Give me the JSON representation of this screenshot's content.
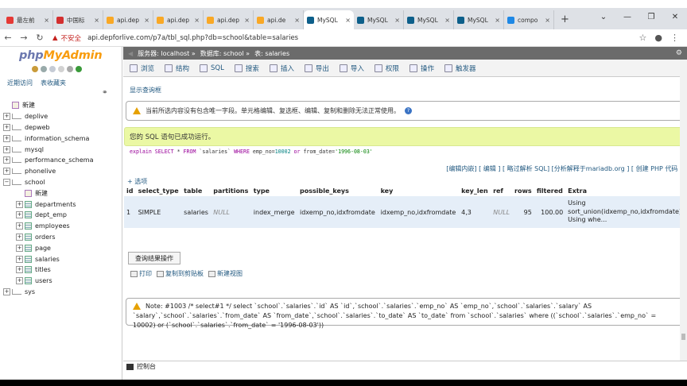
{
  "browser": {
    "tabs": [
      {
        "title": "最左前",
        "color": "#e53935",
        "active": false
      },
      {
        "title": "中国标",
        "color": "#d32f2f",
        "active": false
      },
      {
        "title": "api.dep",
        "color": "#f9a825",
        "active": false
      },
      {
        "title": "api.dep",
        "color": "#f9a825",
        "active": false
      },
      {
        "title": "api.dep",
        "color": "#f9a825",
        "active": false
      },
      {
        "title": "api.de",
        "color": "#f9a825",
        "active": false
      },
      {
        "title": "MySQL",
        "color": "#0d5f8a",
        "active": true
      },
      {
        "title": "MySQL",
        "color": "#0d5f8a",
        "active": false
      },
      {
        "title": "MySQL",
        "color": "#0d5f8a",
        "active": false
      },
      {
        "title": "MySQL",
        "color": "#0d5f8a",
        "active": false
      },
      {
        "title": "compo",
        "color": "#1e88e5",
        "active": false
      }
    ],
    "new_tab": "+",
    "insecure_label": "不安全",
    "url": "api.depforlive.com/p7a/tbl_sql.php?db=school&table=salaries"
  },
  "sidebar": {
    "logo_php": "php",
    "logo_myadmin": "MyAdmin",
    "recent": "近期访问",
    "favorites": "表收藏夹",
    "tree": [
      {
        "label": "新建",
        "level": 0,
        "type": "new",
        "exp": ""
      },
      {
        "label": "deplive",
        "level": 0,
        "type": "db",
        "exp": "+"
      },
      {
        "label": "depweb",
        "level": 0,
        "type": "db",
        "exp": "+"
      },
      {
        "label": "information_schema",
        "level": 0,
        "type": "db",
        "exp": "+"
      },
      {
        "label": "mysql",
        "level": 0,
        "type": "db",
        "exp": "+"
      },
      {
        "label": "performance_schema",
        "level": 0,
        "type": "db",
        "exp": "+"
      },
      {
        "label": "phonelive",
        "level": 0,
        "type": "db",
        "exp": "+"
      },
      {
        "label": "school",
        "level": 0,
        "type": "db",
        "exp": "−"
      },
      {
        "label": "新建",
        "level": 1,
        "type": "new",
        "exp": ""
      },
      {
        "label": "departments",
        "level": 1,
        "type": "table",
        "exp": "+"
      },
      {
        "label": "dept_emp",
        "level": 1,
        "type": "table",
        "exp": "+"
      },
      {
        "label": "employees",
        "level": 1,
        "type": "table",
        "exp": "+"
      },
      {
        "label": "orders",
        "level": 1,
        "type": "table",
        "exp": "+"
      },
      {
        "label": "page",
        "level": 1,
        "type": "table",
        "exp": "+"
      },
      {
        "label": "salaries",
        "level": 1,
        "type": "table",
        "exp": "+"
      },
      {
        "label": "titles",
        "level": 1,
        "type": "table",
        "exp": "+"
      },
      {
        "label": "users",
        "level": 1,
        "type": "table",
        "exp": "+"
      },
      {
        "label": "sys",
        "level": 0,
        "type": "db",
        "exp": "+"
      }
    ]
  },
  "breadcrumb": {
    "server": "服务器: localhost »",
    "db": "数据库: school »",
    "table": "表: salaries"
  },
  "menu": [
    "浏览",
    "结构",
    "SQL",
    "搜索",
    "插入",
    "导出",
    "导入",
    "权限",
    "操作",
    "触发器"
  ],
  "show_query": "显示查询框",
  "notice": "当前所选内容没有包含唯一字段。单元格编辑、复选框、编辑、复制和删除无法正常使用。",
  "success": "您的 SQL 语句已成功运行。",
  "sql": {
    "explain": "explain",
    "select": "SELECT",
    "star": " * ",
    "from": "FROM",
    "table": " `salaries` ",
    "where": "WHERE",
    "cond1": " emp_no=",
    "val1": "10002",
    "or": " or ",
    "cond2": "from_date=",
    "val2": "'1996-08-03'"
  },
  "sql_links": "[编辑内嵌] [ 编辑 ] [ 略过解析 SQL] [分析解释于mariadb.org ] [ 创建 PHP 代码 ]",
  "options": "+ 选项",
  "result": {
    "columns": [
      "id",
      "select_type",
      "table",
      "partitions",
      "type",
      "possible_keys",
      "key",
      "key_len",
      "ref",
      "rows",
      "filtered",
      "Extra"
    ],
    "rows": [
      {
        "id": "1",
        "select_type": "SIMPLE",
        "table": "salaries",
        "partitions": "NULL",
        "type": "index_merge",
        "possible_keys": "idxemp_no,idxfromdate",
        "key": "idxemp_no,idxfromdate",
        "key_len": "4,3",
        "ref": "NULL",
        "rows": "95",
        "filtered": "100.00",
        "extra_1": "Using",
        "extra_2": "sort_union(idxemp_no,idxfromdate);",
        "extra_3": "Using whe..."
      }
    ]
  },
  "query_ops": {
    "title": "查询结果操作",
    "print": "打印",
    "copy": "复制到剪贴板",
    "view": "新建视图"
  },
  "note": "Note: #1003 /* select#1 */ select `school`.`salaries`.`id` AS `id`,`school`.`salaries`.`emp_no` AS `emp_no`,`school`.`salaries`.`salary` AS `salary`,`school`.`salaries`.`from_date` AS `from_date`,`school`.`salaries`.`to_date` AS `to_date` from `school`.`salaries` where ((`school`.`salaries`.`emp_no` = 10002) or (`school`.`salaries`.`from_date` = '1996-08-03'))",
  "console": "控制台"
}
